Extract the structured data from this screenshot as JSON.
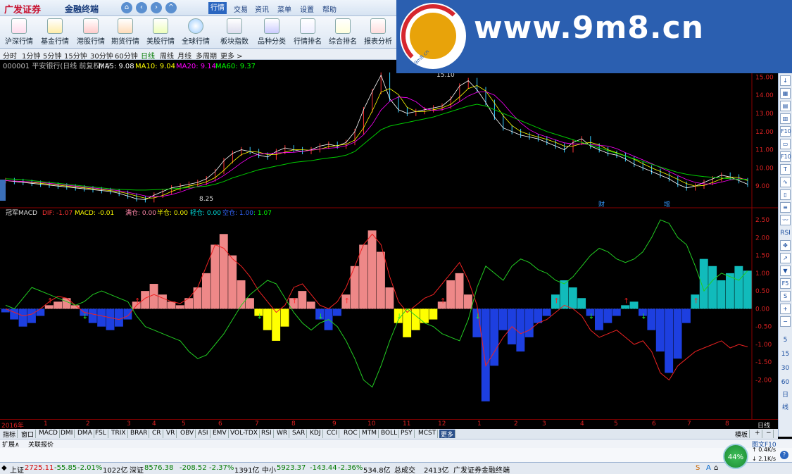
{
  "app": {
    "brand": "广发证券",
    "sub": "金融终端"
  },
  "menus": [
    "行情",
    "交易",
    "资讯",
    "菜单",
    "设置",
    "帮助"
  ],
  "toolbar": [
    "沪深行情",
    "基金行情",
    "港股行情",
    "期货行情",
    "美股行情",
    "全球行情",
    "板块指数",
    "品种分类",
    "行情排名",
    "综合排名",
    "报表分析"
  ],
  "periods": [
    "分时",
    "1分钟",
    "5分钟",
    "15分钟",
    "30分钟",
    "60分钟",
    "日线",
    "周线",
    "月线",
    "多周期",
    "更多 >"
  ],
  "active_period": "日线",
  "stock_header": {
    "name": "000001 平安银行(日线 前复权) ▽",
    "ma5": "MA5: 9.08",
    "ma10": "MA10: 9.04",
    "ma20": "MA20: 9.14",
    "ma60": "MA60: 9.37"
  },
  "price_labels": {
    "high": "15.10",
    "low": "8.25",
    "markers": [
      "财",
      "增"
    ]
  },
  "price_axis": [
    "15.00",
    "14.00",
    "13.00",
    "12.00",
    "11.00",
    "10.00",
    "9.00"
  ],
  "macd_header": {
    "name": "冠军MACD",
    "dif": "DIF: -1.07",
    "macd": "MACD: -0.01",
    "full": "满仓: 0.00",
    "half": "半仓: 0.00",
    "light": "轻仓: 0.00",
    "empty": "空仓: 1.00",
    "last": ": 1.07"
  },
  "macd_axis": [
    "2.50",
    "2.00",
    "1.50",
    "1.00",
    "0.50",
    "0.00",
    "-0.50",
    "-1.00",
    "-1.50",
    "-2.00"
  ],
  "side_icons": [
    "up-arrow",
    "grid",
    "table",
    "bar",
    "f10",
    "f10b",
    "ft",
    "chart",
    "rsi",
    "move",
    "rsi2",
    "down",
    "f5",
    "s",
    "plus",
    "minus",
    "5",
    "15",
    "30",
    "60",
    "日",
    "线"
  ],
  "side_labels": {
    "rsi": "RSI",
    "f10": "F10",
    "f5": "F5",
    "n5": "5",
    "n15": "15",
    "n30": "30",
    "n60": "60",
    "day": "日",
    "line": "线"
  },
  "time_axis": [
    "2016年",
    "1",
    "2",
    "3",
    "4",
    "5",
    "6",
    "7",
    "8",
    "9",
    "10",
    "11",
    "12",
    "1",
    "2",
    "3",
    "4",
    "5",
    "6",
    "7",
    "8",
    "日线"
  ],
  "indicator_tabs": [
    "指标",
    "窗口",
    "MACD",
    "DMI",
    "DMA",
    "FSL",
    "TRIX",
    "BRAR",
    "CR",
    "VR",
    "OBV",
    "ASI",
    "EMV",
    "VOL-TDX",
    "RSI",
    "WR",
    "SAR",
    "KDJ",
    "CCI",
    "ROC",
    "MTM",
    "BOLL",
    "PSY",
    "MCST",
    "更多"
  ],
  "template_label": "模板",
  "sub_tabs": [
    "扩展∧",
    "关联报价"
  ],
  "right_sub": "图文F10",
  "status": {
    "sh_label": "上证",
    "sh_value": "2725.11",
    "sh_change": "-55.85",
    "sh_pct": "-2.01%",
    "sh_amount": "1022亿",
    "sz_label": "深证",
    "sz_value": "8576.38",
    "sz_change": "-208.52",
    "sz_pct": "-2.37%",
    "sz_amount": "1391亿",
    "zx_label": "中小",
    "zx_value": "5923.37",
    "zx_change": "-143.44",
    "zx_pct": "-2.36%",
    "zx_amount": "534.8亿",
    "total_label": "总成交",
    "total_value": "2413亿",
    "broker": "广发证券金融终端"
  },
  "gauge": "44%",
  "speed_up": "0.4K/s",
  "speed_down": "2.1K/s",
  "watermark": "www.9m8.cn",
  "watermark_small": "www.9m8.cn",
  "chart_data": {
    "type": "line",
    "price": [
      9.3,
      9.25,
      9.2,
      9.15,
      9.1,
      9.05,
      9.0,
      8.95,
      8.9,
      8.85,
      8.8,
      8.75,
      8.7,
      8.6,
      8.45,
      8.3,
      8.25,
      8.5,
      8.7,
      8.9,
      9.0,
      9.1,
      9.2,
      9.4,
      9.8,
      10.4,
      10.8,
      11.0,
      10.9,
      10.7,
      10.6,
      10.9,
      11.1,
      11.0,
      10.9,
      11.0,
      11.2,
      11.3,
      11.2,
      11.4,
      12.0,
      13.2,
      14.2,
      15.1,
      13.8,
      13.2,
      13.0,
      13.1,
      13.2,
      13.3,
      13.4,
      13.8,
      14.5,
      14.8,
      14.3,
      13.6,
      12.8,
      12.2,
      12.0,
      11.8,
      11.7,
      11.6,
      11.4,
      11.2,
      11.0,
      11.4,
      11.6,
      11.2,
      11.0,
      10.8,
      10.7,
      10.5,
      10.2,
      10.0,
      9.8,
      9.6,
      9.4,
      9.1,
      8.9,
      9.0,
      9.2,
      9.4,
      9.6,
      9.5,
      9.3,
      9.1
    ],
    "ma60": [
      9.4,
      9.38,
      9.35,
      9.3,
      9.25,
      9.2,
      9.15,
      9.1,
      9.05,
      9.0,
      8.95,
      8.9,
      8.85,
      8.82,
      8.8,
      8.78,
      8.78,
      8.8,
      8.82,
      8.85,
      8.88,
      8.92,
      8.96,
      9.0,
      9.1,
      9.25,
      9.45,
      9.6,
      9.75,
      9.9,
      10.0,
      10.1,
      10.2,
      10.3,
      10.35,
      10.4,
      10.48,
      10.55,
      10.6,
      10.7,
      10.9,
      11.3,
      11.7,
      12.1,
      12.3,
      12.4,
      12.5,
      12.6,
      12.7,
      12.8,
      12.95,
      13.1,
      13.25,
      13.4,
      13.5,
      13.4,
      13.2,
      13.0,
      12.8,
      12.6,
      12.4,
      12.2,
      12.0,
      11.85,
      11.7,
      11.55,
      11.4,
      11.25,
      11.1,
      10.95,
      10.8,
      10.65,
      10.5,
      10.35,
      10.2,
      10.05,
      9.9,
      9.75,
      9.65,
      9.58,
      9.52,
      9.48,
      9.44,
      9.4,
      9.38,
      9.37
    ],
    "macd_hist": [
      -0.1,
      -0.3,
      -0.5,
      -0.4,
      -0.2,
      0.1,
      0.2,
      0.3,
      0.1,
      -0.2,
      -0.4,
      -0.5,
      -0.6,
      -0.5,
      -0.3,
      0.2,
      0.5,
      0.7,
      0.4,
      0.2,
      0.1,
      0.3,
      0.6,
      1.0,
      1.8,
      2.1,
      1.5,
      0.8,
      0.3,
      -0.2,
      -0.6,
      -0.9,
      -0.5,
      0.3,
      0.5,
      0.2,
      -0.3,
      -0.6,
      -0.2,
      0.4,
      1.2,
      1.8,
      2.2,
      1.6,
      0.6,
      -0.4,
      -0.8,
      -0.6,
      -0.4,
      -0.3,
      0.2,
      0.8,
      1.0,
      0.4,
      -0.8,
      -2.6,
      -1.6,
      -0.6,
      -1.0,
      -1.2,
      -0.8,
      -0.4,
      -0.2,
      0.4,
      0.8,
      0.6,
      0.3,
      -0.2,
      -0.6,
      -0.4,
      -0.2,
      0.1,
      0.2,
      -0.2,
      -0.6,
      -1.2,
      -1.8,
      -1.4,
      -0.4,
      0.4,
      1.4,
      1.2,
      0.8,
      1.0,
      1.2,
      1.07
    ],
    "dif": [
      0.0,
      -0.1,
      -0.2,
      -0.15,
      0.0,
      0.2,
      0.35,
      0.3,
      0.1,
      -0.1,
      -0.15,
      -0.2,
      -0.25,
      -0.3,
      -0.2,
      0.1,
      0.3,
      0.4,
      0.3,
      0.2,
      0.15,
      0.3,
      0.6,
      1.2,
      1.8,
      1.7,
      1.4,
      1.2,
      0.9,
      0.5,
      0.2,
      -0.1,
      0.1,
      0.6,
      0.7,
      0.4,
      0.1,
      0.0,
      0.2,
      0.6,
      1.2,
      1.8,
      2.1,
      1.8,
      0.9,
      0.2,
      -0.1,
      0.1,
      0.3,
      0.4,
      0.7,
      1.0,
      1.3,
      0.8,
      0.1,
      -1.6,
      -1.2,
      -0.8,
      -0.5,
      -0.7,
      -0.6,
      -0.4,
      -0.3,
      -0.1,
      0.1,
      0.0,
      -0.2,
      -0.6,
      -0.8,
      -0.7,
      -0.6,
      -0.8,
      -1.0,
      -0.9,
      -1.2,
      -1.8,
      -2.0,
      -1.6,
      -1.4,
      -1.2,
      -1.1,
      -1.0,
      -0.9,
      -1.1,
      -1.0,
      -1.07
    ],
    "dea": [
      0.1,
      0.0,
      0.3,
      0.6,
      0.5,
      0.4,
      0.3,
      0.2,
      0.1,
      0.2,
      0.4,
      0.5,
      0.4,
      0.3,
      0.2,
      -0.2,
      -0.5,
      -0.6,
      -0.7,
      -0.8,
      -0.9,
      -1.2,
      -1.4,
      -1.3,
      -1.0,
      -0.7,
      -0.3,
      0.1,
      0.4,
      0.6,
      0.8,
      0.7,
      0.3,
      -0.1,
      -0.4,
      -0.6,
      -0.4,
      -0.3,
      -0.5,
      -0.9,
      -1.4,
      -2.0,
      -2.2,
      -1.6,
      -0.9,
      -0.3,
      0.0,
      -0.2,
      -0.4,
      -0.5,
      -0.7,
      -0.8,
      -0.9,
      -0.3,
      0.6,
      1.2,
      1.0,
      0.8,
      1.2,
      1.4,
      1.3,
      1.1,
      1.0,
      0.8,
      0.7,
      0.9,
      1.2,
      1.5,
      1.7,
      1.6,
      1.4,
      1.3,
      1.4,
      1.6,
      2.0,
      2.5,
      2.4,
      2.0,
      1.8,
      1.2,
      0.5,
      0.8,
      1.0,
      0.9,
      0.8,
      1.07
    ]
  }
}
